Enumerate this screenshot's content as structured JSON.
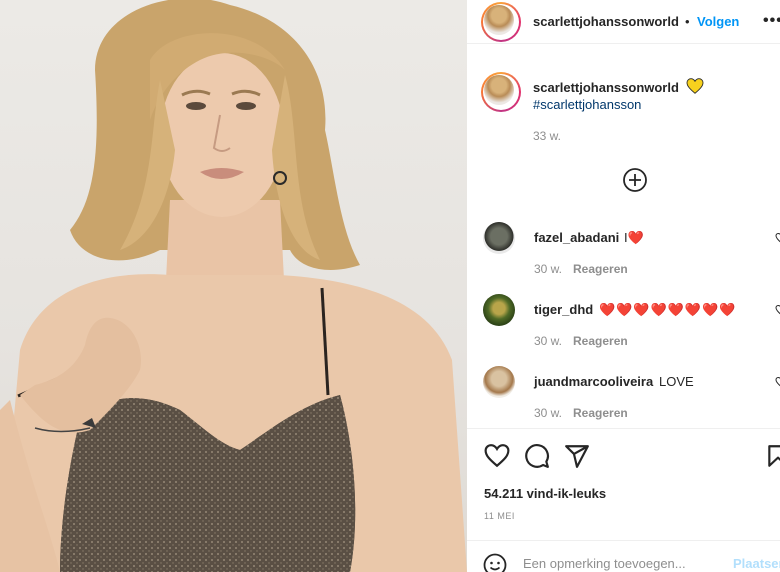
{
  "post": {
    "username": "scarlettjohanssonworld",
    "follow_label": "Volgen",
    "separator": "•",
    "more_label": "•••"
  },
  "caption": {
    "username": "scarlettjohanssonworld",
    "hashtag": "#scarlettjohansson",
    "time": "33 w."
  },
  "comments": [
    {
      "author": "fazel_abadani",
      "text": "I❤️",
      "time": "30 w.",
      "reply_label": "Reageren"
    },
    {
      "author": "tiger_dhd",
      "text": "❤️❤️❤️❤️❤️❤️❤️❤️",
      "time": "30 w.",
      "reply_label": "Reageren"
    },
    {
      "author": "juandmarcooliveira",
      "text": "LOVE",
      "time": "30 w.",
      "reply_label": "Reageren"
    }
  ],
  "actions": {
    "likes": "54.211 vind-ik-leuks",
    "date": "11 MEI"
  },
  "composer": {
    "placeholder": "Een opmerking toevoegen...",
    "post_label": "Plaatsen"
  },
  "colors": {
    "accent": "#0095f6",
    "link": "#00376b",
    "muted": "#8e8e8e",
    "heart": "#ed1b24"
  }
}
